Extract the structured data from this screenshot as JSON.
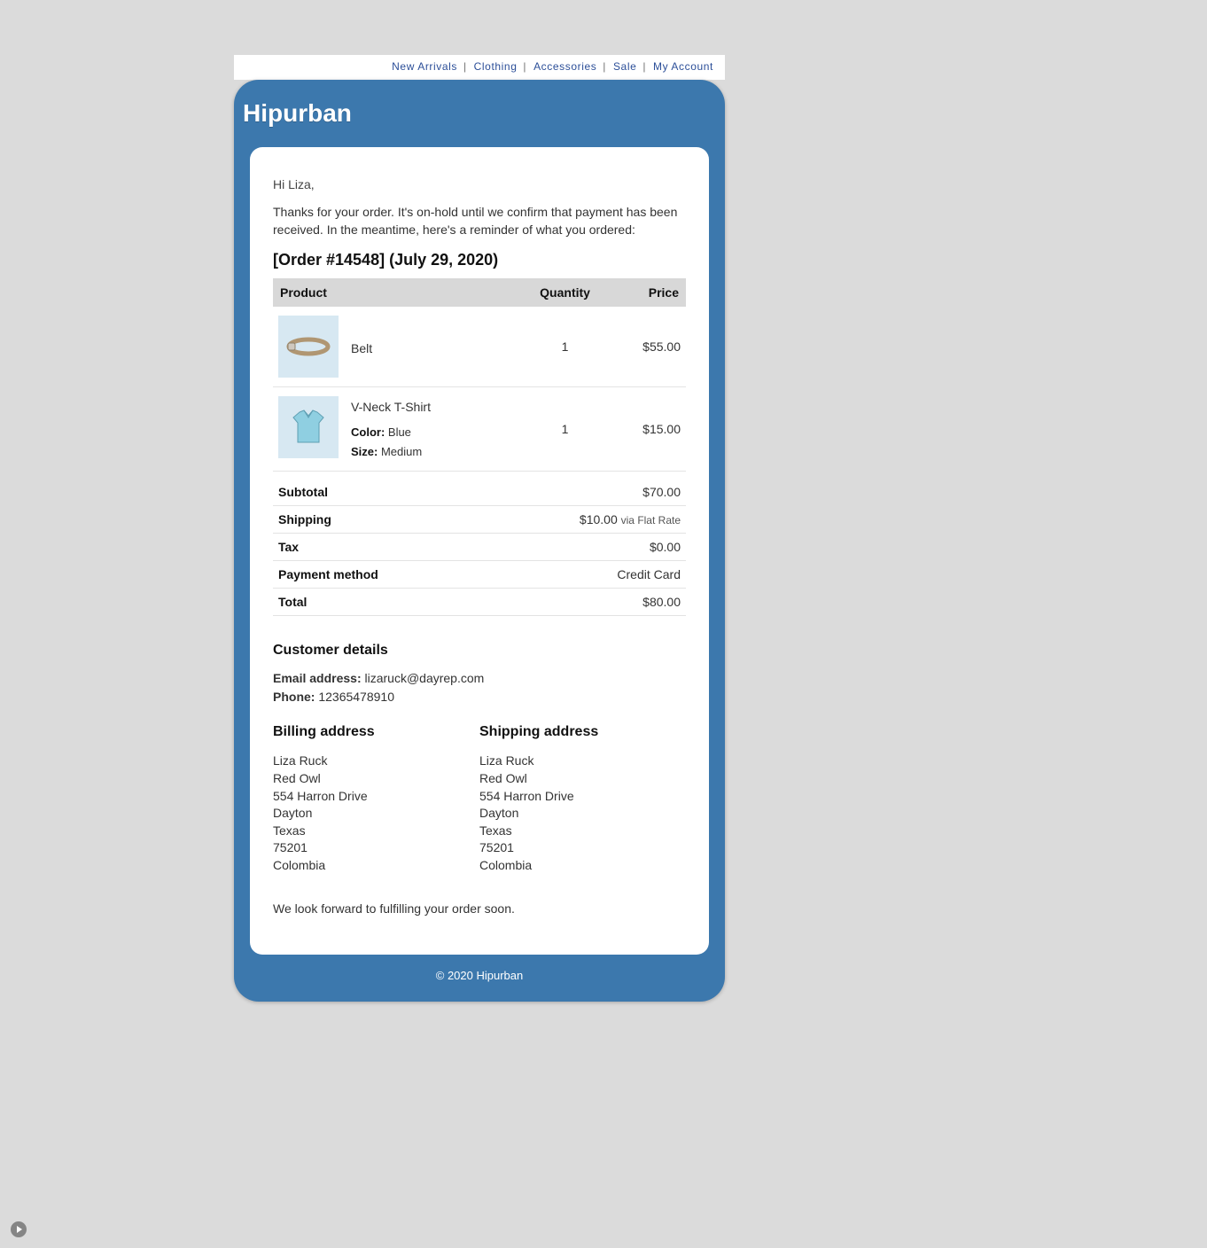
{
  "nav": {
    "items": [
      "New Arrivals",
      "Clothing",
      "Accessories",
      "Sale",
      "My Account"
    ]
  },
  "brand": "Hipurban",
  "greeting": "Hi Liza,",
  "intro": "Thanks for your order. It's on-hold until we confirm that payment has been received. In the meantime, here's a reminder of what you ordered:",
  "order_heading": "[Order #14548] (July 29, 2020)",
  "columns": {
    "product": "Product",
    "quantity": "Quantity",
    "price": "Price"
  },
  "items": [
    {
      "name": "Belt",
      "qty": "1",
      "price": "$55.00",
      "options": []
    },
    {
      "name": "V-Neck T-Shirt",
      "qty": "1",
      "price": "$15.00",
      "options": [
        {
          "label": "Color:",
          "value": " Blue"
        },
        {
          "label": "Size:",
          "value": " Medium"
        }
      ]
    }
  ],
  "totals": {
    "subtotal_label": "Subtotal",
    "subtotal": "$70.00",
    "shipping_label": "Shipping",
    "shipping_amount": "$10.00 ",
    "shipping_via": "via Flat Rate",
    "tax_label": "Tax",
    "tax": "$0.00",
    "payment_method_label": "Payment method",
    "payment_method": "Credit Card",
    "total_label": "Total",
    "total": "$80.00"
  },
  "customer_heading": "Customer details",
  "customer": {
    "email_label": "Email address:",
    "email": " lizaruck@dayrep.com",
    "phone_label": "Phone:",
    "phone": " 12365478910"
  },
  "billing_heading": "Billing address",
  "shipping_heading": "Shipping address",
  "billing": [
    "Liza Ruck",
    "Red Owl",
    "554 Harron Drive",
    "Dayton",
    "Texas",
    "75201",
    "Colombia"
  ],
  "shipping": [
    "Liza Ruck",
    "Red Owl",
    "554 Harron Drive",
    "Dayton",
    "Texas",
    "75201",
    "Colombia"
  ],
  "closing": "We look forward to fulfilling your order soon.",
  "footer": "© 2020 Hipurban"
}
